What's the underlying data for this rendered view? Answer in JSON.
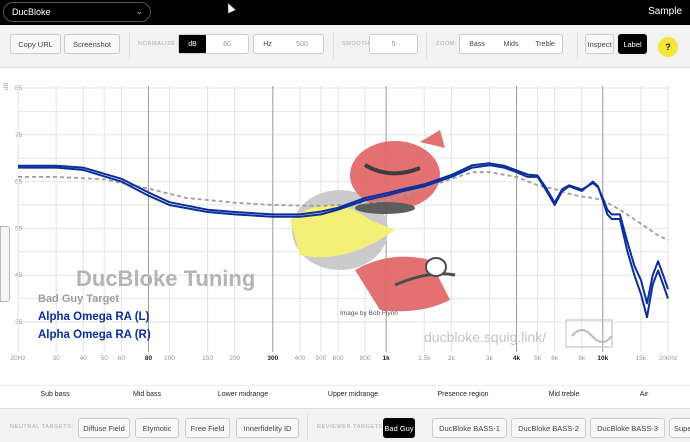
{
  "topbar": {
    "site": "DucBloke",
    "right_link": "Sample"
  },
  "controls": {
    "copy_url": "Copy URL",
    "screenshot": "Screenshot",
    "normalize_label": "NORMALIZE:",
    "normalize_db": "dB",
    "normalize_db_value": "60",
    "normalize_hz": "Hz",
    "normalize_hz_value": "500",
    "smooth_label": "SMOOTH:",
    "smooth_value": "5",
    "zoom_label": "ZOOM:",
    "zoom_options": [
      "Bass",
      "Mids",
      "Treble"
    ],
    "inspect": "Inspect",
    "label": "Label",
    "help": "?"
  },
  "graph": {
    "y_unit": "dB",
    "y_ticks": [
      "85",
      "75",
      "65",
      "55",
      "45",
      "35"
    ],
    "x_ticks": [
      "20Hz",
      "30",
      "40",
      "50",
      "60",
      "80",
      "100",
      "150",
      "200",
      "300",
      "400",
      "500",
      "600",
      "800",
      "1k",
      "1.5k",
      "2k",
      "3k",
      "4k",
      "5k",
      "6k",
      "8k",
      "10k",
      "15k",
      "20kHz"
    ],
    "watermark_title": "DucBloke Tuning",
    "watermark_url": "ducbloke.squig.link/",
    "image_credit": "Image by Bob Flynn",
    "legend": [
      {
        "name": "Bad Guy Target",
        "color": "#9e9e9e"
      },
      {
        "name": "Alpha Omega RA (L)",
        "color": "#0a2f9c"
      },
      {
        "name": "Alpha Omega RA (R)",
        "color": "#0a2f9c"
      }
    ]
  },
  "chart_data": {
    "type": "line",
    "xscale": "log",
    "xlim": [
      20,
      20000
    ],
    "ylim": [
      30,
      85
    ],
    "ylabel": "dB",
    "series": [
      {
        "name": "Bad Guy Target",
        "color": "#9e9e9e",
        "dashed": true,
        "x": [
          20,
          30,
          50,
          80,
          120,
          200,
          300,
          500,
          800,
          1000,
          1500,
          2000,
          2500,
          3000,
          4000,
          5000,
          6000,
          7000,
          8000,
          9000,
          10000,
          12000,
          15000,
          18000,
          20000
        ],
        "y": [
          66,
          66,
          65.5,
          63.5,
          61.5,
          60.5,
          60,
          59.8,
          60.3,
          61,
          63.5,
          65.6,
          67,
          67,
          66,
          64.2,
          63.4,
          62.4,
          61.8,
          61.5,
          61,
          59,
          56,
          53.5,
          52.5
        ]
      },
      {
        "name": "Alpha Omega RA (L)",
        "color": "#0a2f9c",
        "x": [
          20,
          30,
          40,
          60,
          80,
          100,
          150,
          200,
          300,
          400,
          500,
          600,
          800,
          1000,
          1200,
          1500,
          2000,
          2500,
          3000,
          3500,
          4000,
          4500,
          5000,
          5500,
          6000,
          6500,
          7000,
          8000,
          9000,
          9500,
          10000,
          10500,
          11000,
          12000,
          13000,
          14000,
          15000,
          16000,
          17000,
          18000,
          19000,
          20000
        ],
        "y": [
          68,
          68,
          67.5,
          65,
          62,
          60,
          58.5,
          58,
          57.5,
          57.5,
          58,
          59,
          61,
          62,
          63,
          64,
          66,
          68,
          68.5,
          68,
          67,
          66,
          66,
          63,
          60,
          63,
          64,
          63,
          65,
          64,
          61,
          58,
          57,
          57,
          50,
          45,
          41,
          36,
          43,
          46,
          43,
          40
        ]
      },
      {
        "name": "Alpha Omega RA (R)",
        "color": "#0a2f9c",
        "x": [
          20,
          30,
          40,
          60,
          80,
          100,
          150,
          200,
          300,
          400,
          500,
          600,
          800,
          1000,
          1200,
          1500,
          2000,
          2500,
          3000,
          3500,
          4000,
          4500,
          5000,
          5500,
          6000,
          6500,
          7000,
          8000,
          9000,
          9500,
          10000,
          10500,
          11000,
          12000,
          13000,
          14000,
          15000,
          16000,
          17000,
          18000,
          19000,
          20000
        ],
        "y": [
          68.4,
          68.4,
          68,
          65.6,
          62.7,
          60.6,
          59,
          58.5,
          58,
          58,
          58.6,
          59.4,
          61.5,
          62.5,
          63.4,
          64.4,
          66.4,
          68.5,
          68.9,
          68.4,
          67.4,
          66.5,
          66.3,
          63.5,
          60.5,
          63.4,
          64.2,
          63.3,
          64.7,
          63.8,
          61.5,
          59,
          58,
          58,
          52,
          47,
          44,
          39,
          45,
          48,
          45,
          42
        ]
      }
    ]
  },
  "regions": [
    "Sub bass",
    "Mid bass",
    "Lower midrange",
    "Upper midrange",
    "Presence region",
    "Mid treble",
    "Air"
  ],
  "targets": {
    "neutral_label": "NEUTRAL TARGETS:",
    "neutral": [
      "Diffuse Field",
      "Etymotic",
      "Free Field",
      "Innerfidelity ID"
    ],
    "reviewer_label": "REVIEWER TARGETS:",
    "reviewer": [
      "Bad Guy",
      "DucBloke BASS-1",
      "DucBloke BASS-2",
      "DucBloke BASS-3",
      "Super"
    ]
  }
}
